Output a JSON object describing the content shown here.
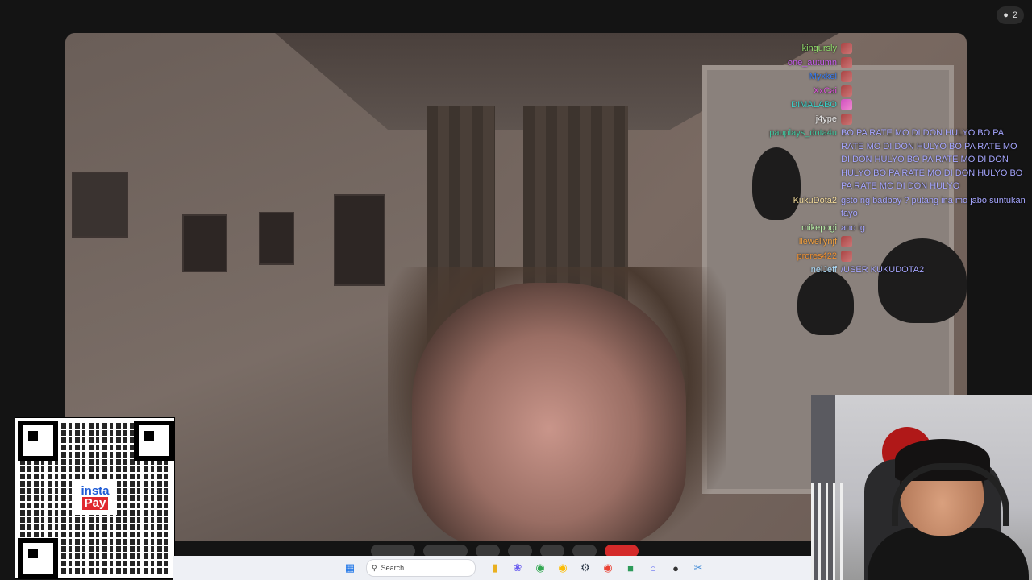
{
  "viewer_count": "2",
  "chat": [
    {
      "user": "kingursly",
      "color": "#8fe06b",
      "message": "",
      "emote": "red"
    },
    {
      "user": "one_autumn",
      "color": "#c65ef0",
      "message": "",
      "emote": "red"
    },
    {
      "user": "Myxkel",
      "color": "#3a7cf0",
      "message": "",
      "emote": "red"
    },
    {
      "user": "XxCai",
      "color": "#e04fe0",
      "message": "",
      "emote": "red"
    },
    {
      "user": "DIMALABO",
      "color": "#38d0c8",
      "message": "",
      "emote": "pink"
    },
    {
      "user": "j4ype",
      "color": "#f0f0f0",
      "message": "",
      "emote": "red"
    },
    {
      "user": "pauplays_dota4u",
      "color": "#40c8a0",
      "message": "BO PA RATE MO DI DON HULYO BO PA RATE MO DI DON HULYO BO PA RATE MO DI DON HULYO BO PA RATE MO DI DON HULYO BO PA RATE MO DI DON HULYO BO PA RATE MO DI DON HULYO",
      "emote": ""
    },
    {
      "user": "KukuDota2",
      "color": "#f0d898",
      "message": "gsto ng badboy ? putang ina mo jabo suntukan tayo",
      "emote": ""
    },
    {
      "user": "mikepogi",
      "color": "#b8f0a8",
      "message": "ano ig",
      "emote": ""
    },
    {
      "user": "llewellynjf",
      "color": "#f0a040",
      "message": "",
      "emote": "red"
    },
    {
      "user": "prores422",
      "color": "#f09030",
      "message": "",
      "emote": "red"
    },
    {
      "user": "nelJeff",
      "color": "#b0e0ff",
      "message": "/USER KUKUDOTA2",
      "emote": ""
    }
  ],
  "qr_logo": {
    "line1": "insta",
    "line2": "Pay"
  },
  "taskbar": {
    "search_placeholder": "Search",
    "icons": [
      "windows-start-icon",
      "search-icon",
      "file-explorer-icon",
      "copilot-icon",
      "chrome-icon",
      "chrome-icon",
      "steam-icon",
      "chrome-icon",
      "app-icon",
      "discord-icon",
      "app-icon",
      "snipping-tool-icon"
    ]
  }
}
